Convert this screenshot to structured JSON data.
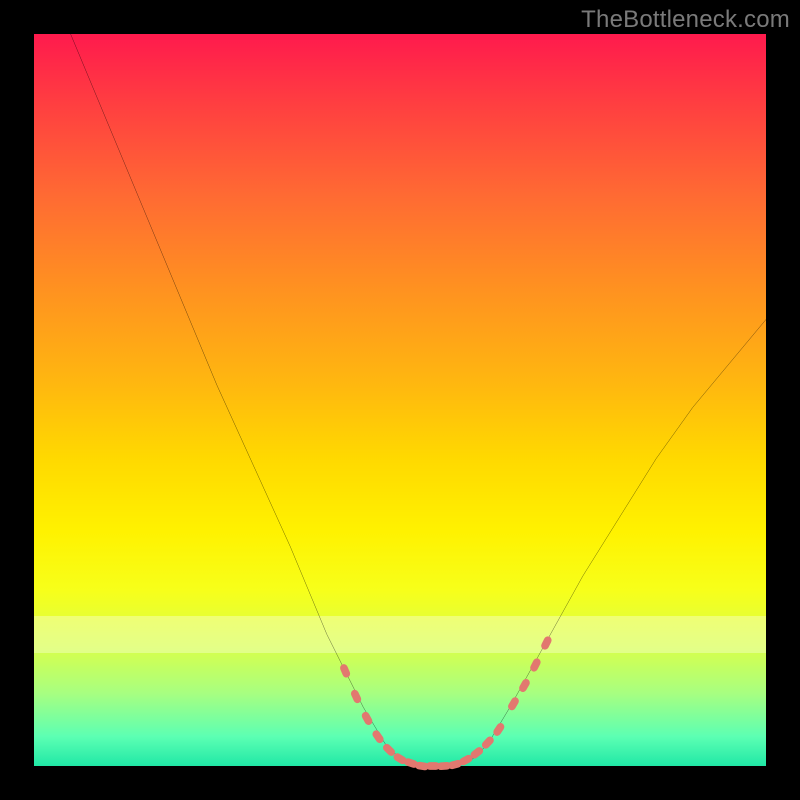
{
  "attribution": "TheBottleneck.com",
  "colors": {
    "frame": "#000000",
    "gradient_top": "#ff1a4d",
    "gradient_bottom": "#20e8a6",
    "curve": "#000000",
    "markers": "#e2786f",
    "light_band": "rgba(255,255,255,0.33)"
  },
  "chart_data": {
    "type": "line",
    "title": "",
    "xlabel": "",
    "ylabel": "",
    "xlim": [
      0,
      100
    ],
    "ylim": [
      0,
      100
    ],
    "grid": false,
    "legend": false,
    "annotations": [],
    "series": [
      {
        "name": "bottleneck-curve",
        "x": [
          5,
          10,
          15,
          20,
          25,
          30,
          35,
          40,
          42,
          45,
          48,
          50,
          52,
          55,
          58,
          60,
          62,
          65,
          70,
          75,
          80,
          85,
          90,
          95,
          100
        ],
        "y": [
          100,
          88,
          76,
          64,
          52,
          41,
          30,
          18,
          14,
          8,
          3,
          1,
          0,
          0,
          0,
          1,
          3,
          8,
          17,
          26,
          34,
          42,
          49,
          55,
          61
        ]
      }
    ],
    "markers": {
      "name": "dotted-segments",
      "x": [
        42.5,
        44.0,
        45.5,
        47.0,
        48.5,
        50.0,
        51.5,
        53.0,
        54.5,
        56.0,
        57.5,
        59.0,
        60.5,
        62.0,
        63.5,
        65.5,
        67.0,
        68.5,
        70.0
      ],
      "y": [
        13.0,
        9.5,
        6.5,
        4.0,
        2.2,
        1.0,
        0.4,
        0.0,
        0.0,
        0.0,
        0.2,
        0.8,
        1.8,
        3.2,
        5.0,
        8.5,
        11.0,
        13.8,
        16.8
      ]
    },
    "light_band_y_range": [
      15.5,
      20.5
    ]
  }
}
